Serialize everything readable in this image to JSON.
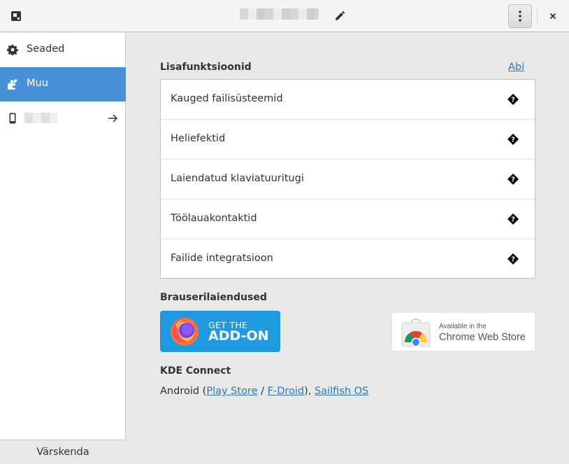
{
  "titlebar": {
    "app_icon": "gsconnect-app-icon",
    "edit_icon": "pencil-icon",
    "menu_icon": "vertical-dots-icon",
    "close_icon": "close-icon"
  },
  "sidebar": {
    "items": [
      {
        "label": "Seaded",
        "icon": "gear-icon"
      },
      {
        "label": "Muu",
        "icon": "puzzle-icon"
      },
      {
        "icon": "smartphone-icon",
        "trailing_icon": "arrow-right-icon"
      }
    ],
    "refresh_label": "Värskenda"
  },
  "plugins": {
    "heading": "Lisafunktsioonid",
    "help_label": "Abi",
    "items": [
      {
        "name": "Kauged failisüsteemid",
        "icon": "missing-image-icon"
      },
      {
        "name": "Heliefektid",
        "icon": "missing-image-icon"
      },
      {
        "name": "Laiendatud klaviatuuritugi",
        "icon": "missing-image-icon"
      },
      {
        "name": "Töölauakontaktid",
        "icon": "missing-image-icon"
      },
      {
        "name": "Failide integratsioon",
        "icon": "missing-image-icon"
      }
    ]
  },
  "browser": {
    "heading": "Brauserilaiendused",
    "firefox": {
      "line1": "GET THE",
      "line2": "ADD-ON"
    },
    "chrome": {
      "line1": "Available in the",
      "line2": "Chrome Web Store"
    }
  },
  "kde": {
    "heading": "KDE Connect",
    "prefix": "Android (",
    "play_store": "Play Store",
    "sep": " / ",
    "fdroid": "F-Droid",
    "suffix": "), ",
    "sailfish": "Sailfish OS"
  },
  "colors": {
    "accent": "#4a90d9",
    "link": "#2a76c6",
    "firefox_badge": "#1f9ae0"
  }
}
